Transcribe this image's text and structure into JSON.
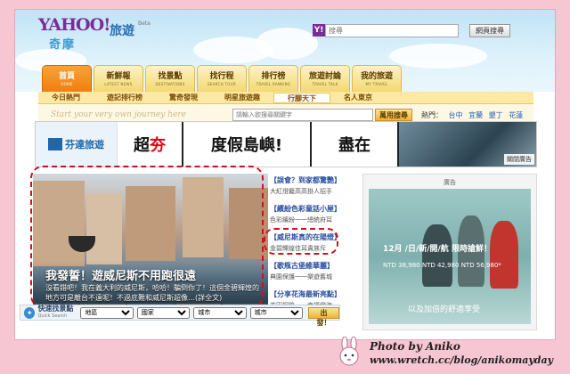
{
  "header": {
    "logo": "YAHOO!",
    "logo_sub": "奇摩",
    "section_title": "旅遊",
    "section_beta": "Beta",
    "search_placeholder": "搜尋",
    "search_button": "網頁搜尋"
  },
  "tabs": [
    {
      "label": "首頁",
      "sub": "HOME",
      "active": true
    },
    {
      "label": "新鮮報",
      "sub": "LATEST NEWS"
    },
    {
      "label": "找景點",
      "sub": "DESTINATIONS"
    },
    {
      "label": "找行程",
      "sub": "SEARCH TOUR"
    },
    {
      "label": "排行榜",
      "sub": "TRAVEL RANKING"
    },
    {
      "label": "旅遊討論",
      "sub": "TRAVEL TALK"
    },
    {
      "label": "我的旅遊",
      "sub": "MY TRAVEL"
    }
  ],
  "subnav": [
    "今日熱門",
    "遊記排行榜",
    "驚奇發現",
    "明星旅遊趣",
    "行腳天下",
    "名人東京"
  ],
  "search": {
    "hint": "Start your very own journey here",
    "placeholder": "請輸入欲搜尋關鍵字",
    "button": "萬用搜尋",
    "popular_label": "熱門：",
    "popular": [
      "台中",
      "宜蘭",
      "墾丁",
      "花蓮"
    ]
  },
  "banner": {
    "brand": "芬達旅遊",
    "cell1_a": "超",
    "cell1_b": "夯",
    "cell2": "度假島嶼!",
    "cell3": "盡在",
    "close": "關閉廣告"
  },
  "feature": {
    "title": "我發誓！遊威尼斯不用跑很遠",
    "body": "沒看錯吧！我在義大利的威尼斯，哈哈！騙倒你了！這個金碧輝煌的地方可是離台不遠呢！不過底難和威尼斯超像…(詳全文)"
  },
  "quick_search": {
    "label": "快速找景點",
    "sub": "Quick Search",
    "selects": [
      "地區",
      "國家",
      "城市",
      "城市"
    ],
    "button": "出發！"
  },
  "headlines": [
    {
      "title": "【誤會？到家都驚艷】",
      "sub": "大紅燈籠高高掛人招手"
    },
    {
      "title": "【繽紛色彩童話小屋】",
      "sub": "色彩繽紛一一總統府耳"
    },
    {
      "title": "【威尼斯真的在陽燈】",
      "sub": "金碧輝煌佳耳貴族斥"
    },
    {
      "title": "【歌瓶古堡維華麗】",
      "sub": "典園保護一一樂遊舊城"
    },
    {
      "title": "【分享花海最新亮點】",
      "sub": "花田探險一一幸福燈海"
    }
  ],
  "ad_right": {
    "label": "廣告",
    "price1": "12月 /日/新/開/航 限時搶鮮！",
    "price2": "NTD 38,980  NTD 42,980  NTD 56,980*",
    "tagline": "以及加倍的舒適享受"
  },
  "watermark": {
    "line1": "Photo by Aniko",
    "line2": "www.wretch.cc/blog/anikomayday"
  }
}
